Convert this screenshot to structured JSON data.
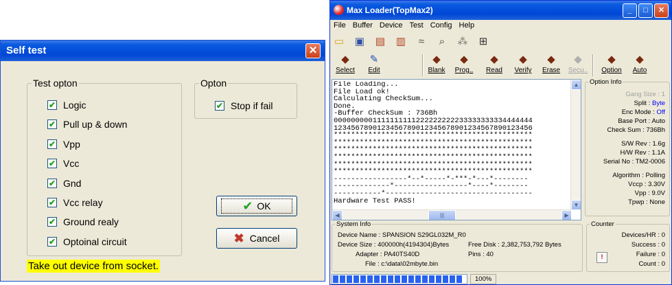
{
  "self_test": {
    "title": "Self test",
    "close_glyph": "✕",
    "test_group_label": "Test opton",
    "tests": [
      {
        "label": "Logic",
        "checked": true
      },
      {
        "label": "Pull up & down",
        "checked": true
      },
      {
        "label": "Vpp",
        "checked": true
      },
      {
        "label": "Vcc",
        "checked": true
      },
      {
        "label": "Gnd",
        "checked": true
      },
      {
        "label": "Vcc relay",
        "checked": true
      },
      {
        "label": "Ground realy",
        "checked": true
      },
      {
        "label": "Optoinal circuit",
        "checked": true
      }
    ],
    "opton_group_label": "Opton",
    "stop_if_fail": {
      "label": "Stop if fail",
      "checked": true
    },
    "ok_label": "OK",
    "cancel_label": "Cancel",
    "status_message": "Take out device from socket.",
    "colors": {
      "highlight": "#ffff00",
      "ok_check": "#21a121",
      "cancel_x": "#c0392b"
    }
  },
  "max_loader": {
    "title": "Max Loader(TopMax2)",
    "window_buttons": [
      "_",
      "□",
      "✕"
    ],
    "menu": [
      "File",
      "Buffer",
      "Device",
      "Test",
      "Config",
      "Help"
    ],
    "toolbar_icons": [
      "open-folder-icon",
      "save-icon",
      "load-chip-icon",
      "save-chip-icon",
      "wave-icon",
      "search-icon",
      "binary-icon",
      "network-icon"
    ],
    "toolbar2": [
      {
        "label": "Select",
        "icon": "chip-question-icon"
      },
      {
        "label": "Edit",
        "icon": "edit-icon"
      },
      {
        "label": "Blank",
        "icon": "blank-chip-icon"
      },
      {
        "label": "Prog..",
        "icon": "program-chip-icon"
      },
      {
        "label": "Read",
        "icon": "read-chip-icon"
      },
      {
        "label": "Verify",
        "icon": "verify-chip-icon"
      },
      {
        "label": "Erase",
        "icon": "erase-chip-icon"
      },
      {
        "label": "Secu..",
        "icon": "secure-chip-icon"
      },
      {
        "label": "Option",
        "icon": "option-chip-icon"
      },
      {
        "label": "Auto",
        "icon": "auto-chip-icon"
      }
    ],
    "log_lines": [
      "File Loading...",
      "File Load ok!",
      "Calculating CheckSum...",
      "Done.",
      "-Buffer CheckSum : 736Bh",
      "0000000001111111111222222222233333333334444444",
      "1234567890123456789012345678901234567890123456",
      "**********************************************",
      "**********************************************",
      "**********************************************",
      "**********************************************",
      "**********************************************",
      "**********************************************",
      "-----------------*--*-----*-***-*---*--------",
      "-------------*-----------------*----*--------",
      "-----------*----------------------------------",
      "Hardware Test PASS!"
    ],
    "option_info": {
      "title": "Option Info",
      "gang_size": {
        "key": "Gang Size :",
        "value": "1"
      },
      "split": {
        "key": "Split :",
        "value": "Byte"
      },
      "enc_mode": {
        "key": "Enc Mode :",
        "value": "Off"
      },
      "base_port": {
        "key": "Base Port :",
        "value": "Auto"
      },
      "check_sum": {
        "key": "Check Sum :",
        "value": "736Bh"
      },
      "sw_rev": {
        "key": "S/W Rev :",
        "value": "1.6g"
      },
      "hw_rev": {
        "key": "H/W Rev :",
        "value": "1.1A"
      },
      "serial": {
        "key": "Serial No :",
        "value": "TM2-0006"
      },
      "algorithm": {
        "key": "Algorithm :",
        "value": "Polling"
      },
      "vccp": {
        "key": "Vccp :",
        "value": "3.30V"
      },
      "vpp": {
        "key": "Vpp :",
        "value": "9.0V"
      },
      "tpwp": {
        "key": "Tpwp :",
        "value": "None"
      }
    },
    "system_info": {
      "title": "System Info",
      "device_name": "Device Name : SPANSION S29GL032M_R0",
      "device_size": "Device Size : 400000h(4194304)Bytes",
      "free_disk": "Free Disk : 2,382,753,792 Bytes",
      "adapter": "Adapter : PA40TS40D",
      "pins": "Pins : 40",
      "file": "File : c:\\data\\02mbyte.bin"
    },
    "counter": {
      "title": "Counter",
      "devices_hr": "Devices/HR : 0",
      "success": "Success : 0",
      "failure": "Failure : 0",
      "count": "Count : 0"
    },
    "progress": {
      "value": 1.0,
      "label": "100%"
    },
    "colors": {
      "accent_blue": "#0000ff",
      "progress": "#2a62f0",
      "grayed": "#a0a0a0"
    }
  }
}
